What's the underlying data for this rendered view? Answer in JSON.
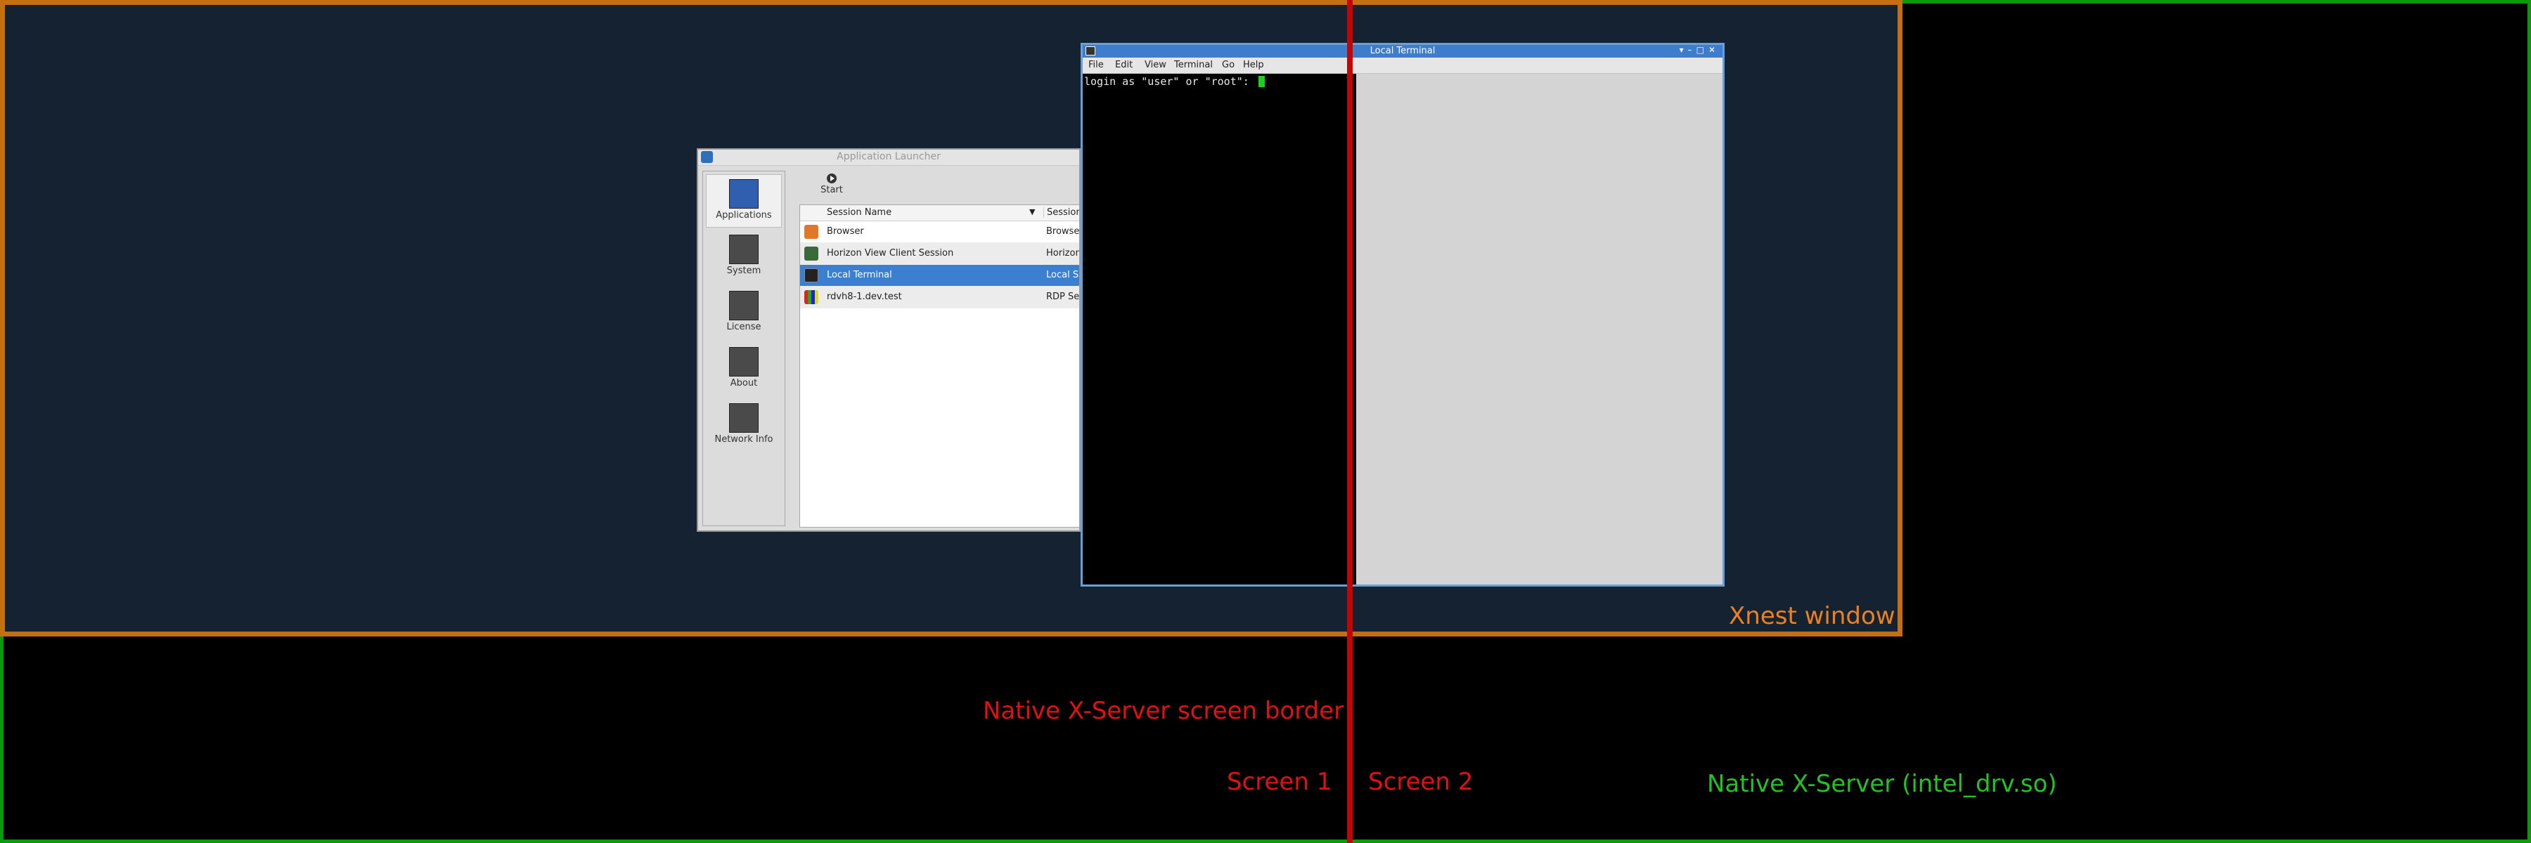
{
  "annotations": {
    "xnest_window": "Xnest window",
    "native_border": "Native X-Server screen border",
    "screen1": "Screen 1",
    "screen2": "Screen 2",
    "native_x": "Native X-Server (intel_drv.so)"
  },
  "colors": {
    "native_x": "#0a9a0a",
    "xnest": "#c46f12",
    "screen_border": "#c10606",
    "desktop": "#152232",
    "selection": "#3b7fd1"
  },
  "launcher": {
    "title": "Application Launcher",
    "sidebar": [
      {
        "label": "Applications",
        "icon": "applications-icon"
      },
      {
        "label": "System",
        "icon": "system-gear-icon"
      },
      {
        "label": "License",
        "icon": "license-list-icon"
      },
      {
        "label": "About",
        "icon": "info-icon"
      },
      {
        "label": "Network Info",
        "icon": "network-plug-icon"
      }
    ],
    "toolbar": {
      "start_label": "Start"
    },
    "table": {
      "col_name": "Session Name",
      "col_type": "Session",
      "rows": [
        {
          "name": "Browser",
          "type": "Browser",
          "icon": "browser-icon"
        },
        {
          "name": "Horizon View Client Session",
          "type": "Horizon",
          "icon": "horizon-icon"
        },
        {
          "name": "Local Terminal",
          "type": "Local S",
          "icon": "terminal-icon"
        },
        {
          "name": "rdvh8-1.dev.test",
          "type": "RDP Se",
          "icon": "rdp-icon"
        }
      ]
    }
  },
  "terminal": {
    "title": "Local Terminal",
    "menu": [
      "File",
      "Edit",
      "View",
      "Terminal",
      "Go",
      "Help"
    ],
    "prompt": "login as \"user\" or \"root\": "
  }
}
